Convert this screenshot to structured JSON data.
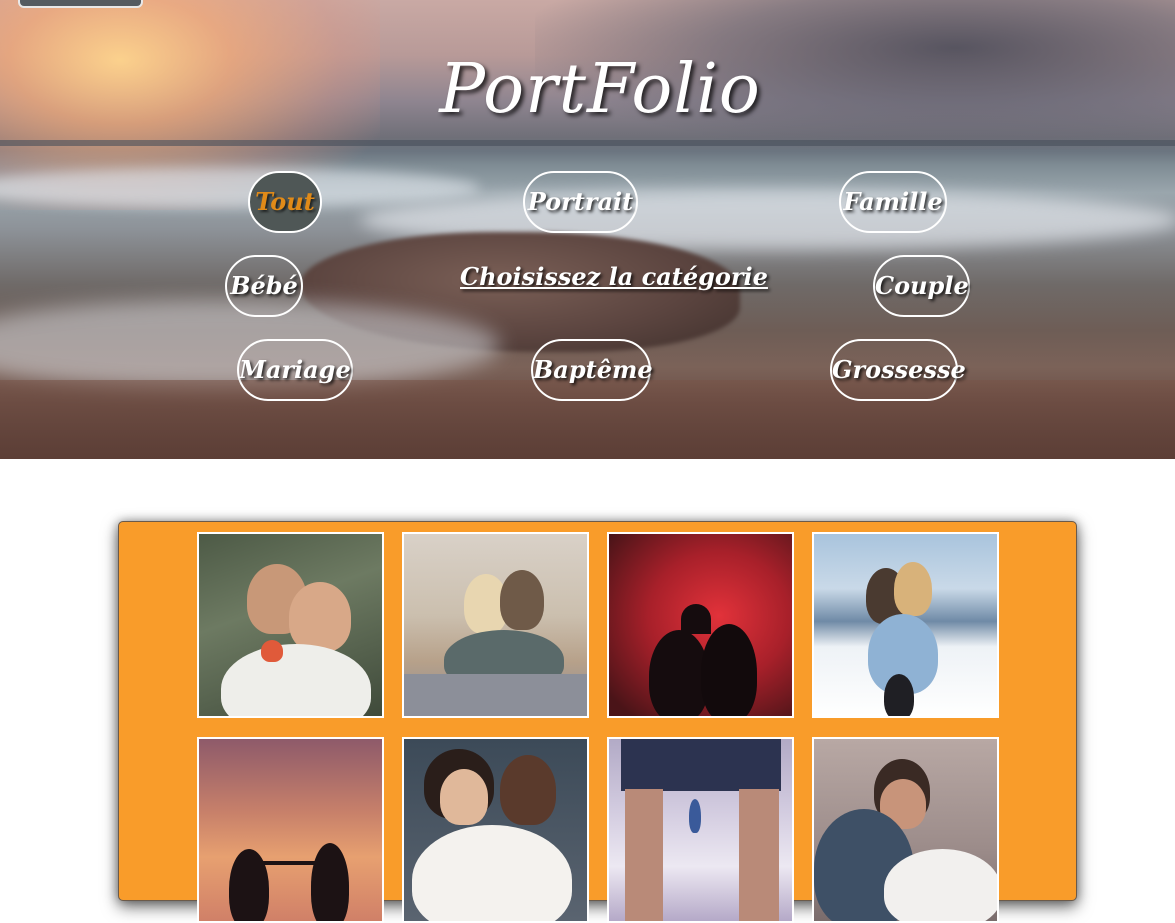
{
  "header": {
    "title": "PortFolio"
  },
  "categories": {
    "label": "Choisissez la catégorie",
    "items": [
      {
        "label": "Tout",
        "active": true
      },
      {
        "label": "Portrait",
        "active": false
      },
      {
        "label": "Famille",
        "active": false
      },
      {
        "label": "Bébé",
        "active": false
      },
      {
        "label": "Couple",
        "active": false
      },
      {
        "label": "Mariage",
        "active": false
      },
      {
        "label": "Baptême",
        "active": false
      },
      {
        "label": "Grossesse",
        "active": false
      }
    ]
  },
  "colors": {
    "gallery_background": "#f99c2a",
    "active_button_background": "#4f5756",
    "active_button_text": "#e08a18"
  },
  "gallery": {
    "photos": [
      {
        "subject": "couple piggyback in forest"
      },
      {
        "subject": "couple sitting on blanket in desert"
      },
      {
        "subject": "couple silhouette forming heart against red sky"
      },
      {
        "subject": "couple kissing in snowy mountains"
      },
      {
        "subject": "couple silhouette holding hands at sunset"
      },
      {
        "subject": "couple portrait embracing"
      },
      {
        "subject": "couple on beach seen through legs"
      },
      {
        "subject": "couple lying down smiling"
      }
    ]
  }
}
